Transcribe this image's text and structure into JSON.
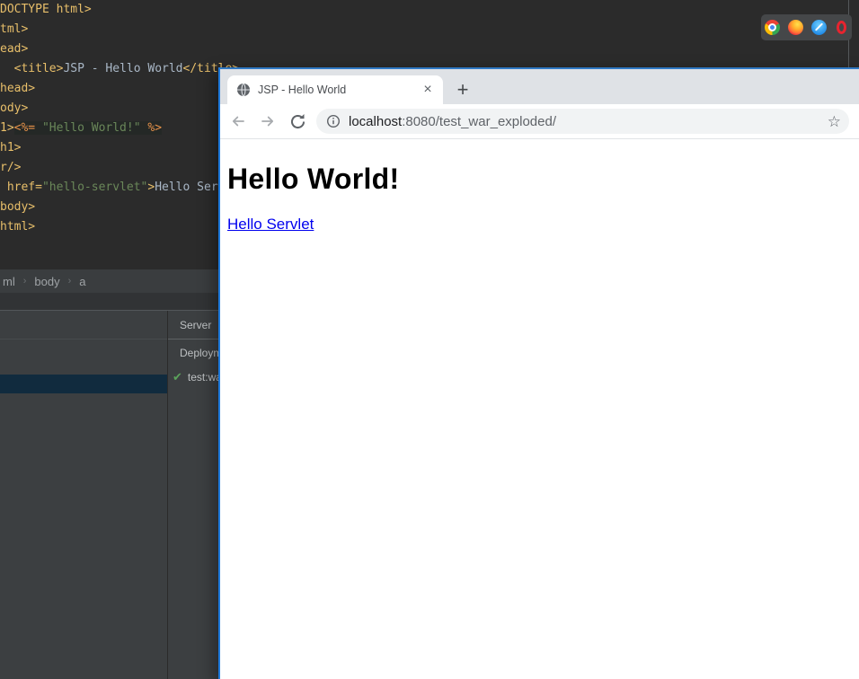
{
  "ide": {
    "code": {
      "lines": [
        {
          "segments": [
            {
              "t": "DOCTYPE html>",
              "s": "tag"
            }
          ]
        },
        {
          "segments": [
            {
              "t": "tml>",
              "s": "tag"
            }
          ]
        },
        {
          "segments": [
            {
              "t": "ead>",
              "s": "tag"
            }
          ]
        },
        {
          "segments": [
            {
              "t": "  ",
              "s": "txt"
            },
            {
              "t": "<title>",
              "s": "tag"
            },
            {
              "t": "JSP - Hello World",
              "s": "txt"
            },
            {
              "t": "</title>",
              "s": "tag"
            }
          ]
        },
        {
          "segments": [
            {
              "t": "head>",
              "s": "tag"
            }
          ]
        },
        {
          "segments": [
            {
              "t": "ody>",
              "s": "tag"
            }
          ]
        },
        {
          "segments": [
            {
              "t": "1>",
              "s": "tag"
            },
            {
              "t": "<%=",
              "s": "jsp",
              "hl": true
            },
            {
              "t": " \"Hello World!\" ",
              "s": "str",
              "hl": true
            },
            {
              "t": "%>",
              "s": "jsp",
              "hl": true
            }
          ]
        },
        {
          "segments": [
            {
              "t": "h1>",
              "s": "tag"
            }
          ]
        },
        {
          "segments": [
            {
              "t": "r/>",
              "s": "tag"
            }
          ]
        },
        {
          "segments": [
            {
              "t": " ",
              "s": "txt"
            },
            {
              "t": "href=",
              "s": "tag"
            },
            {
              "t": "\"hello-servlet\"",
              "s": "str"
            },
            {
              "t": ">",
              "s": "tag"
            },
            {
              "t": "Hello Ser",
              "s": "txt"
            }
          ]
        },
        {
          "segments": [
            {
              "t": "body>",
              "s": "tag"
            }
          ]
        },
        {
          "segments": [
            {
              "t": "html>",
              "s": "tag"
            }
          ]
        }
      ]
    },
    "breadcrumbs": {
      "items": [
        "ml",
        "body",
        "a"
      ],
      "separator": "›"
    },
    "tool_panel": {
      "server_header": "Server",
      "deployment_header": "Deploym",
      "deployment_item": "test:wa",
      "item_check": "✔"
    },
    "browser_bar_icons": [
      "chrome-icon",
      "firefox-icon",
      "safari-icon",
      "opera-icon"
    ]
  },
  "browser": {
    "tab": {
      "title": "JSP - Hello World",
      "close_label": "×"
    },
    "new_tab_label": "+",
    "url": {
      "host": "localhost",
      "path": ":8080/test_war_exploded/"
    },
    "star_label": "☆",
    "page": {
      "heading": "Hello World!",
      "link_text": "Hello Servlet"
    }
  },
  "colors": {
    "editor_bg": "#2b2b2b",
    "panel_bg": "#3c3f41",
    "selection_blue": "#112b3e",
    "code_tag": "#e8bf6a",
    "code_jsp_delim": "#e8924a",
    "code_string": "#6a8759",
    "code_text": "#a9b7c6",
    "check_green": "#5ba35b",
    "window_border_blue": "#1f7adb",
    "tab_strip": "#dfe2e6",
    "omnibox_bg": "#f1f3f4",
    "url_host": "#202124",
    "url_path": "#5f6368",
    "link_blue": "#0000ee"
  }
}
